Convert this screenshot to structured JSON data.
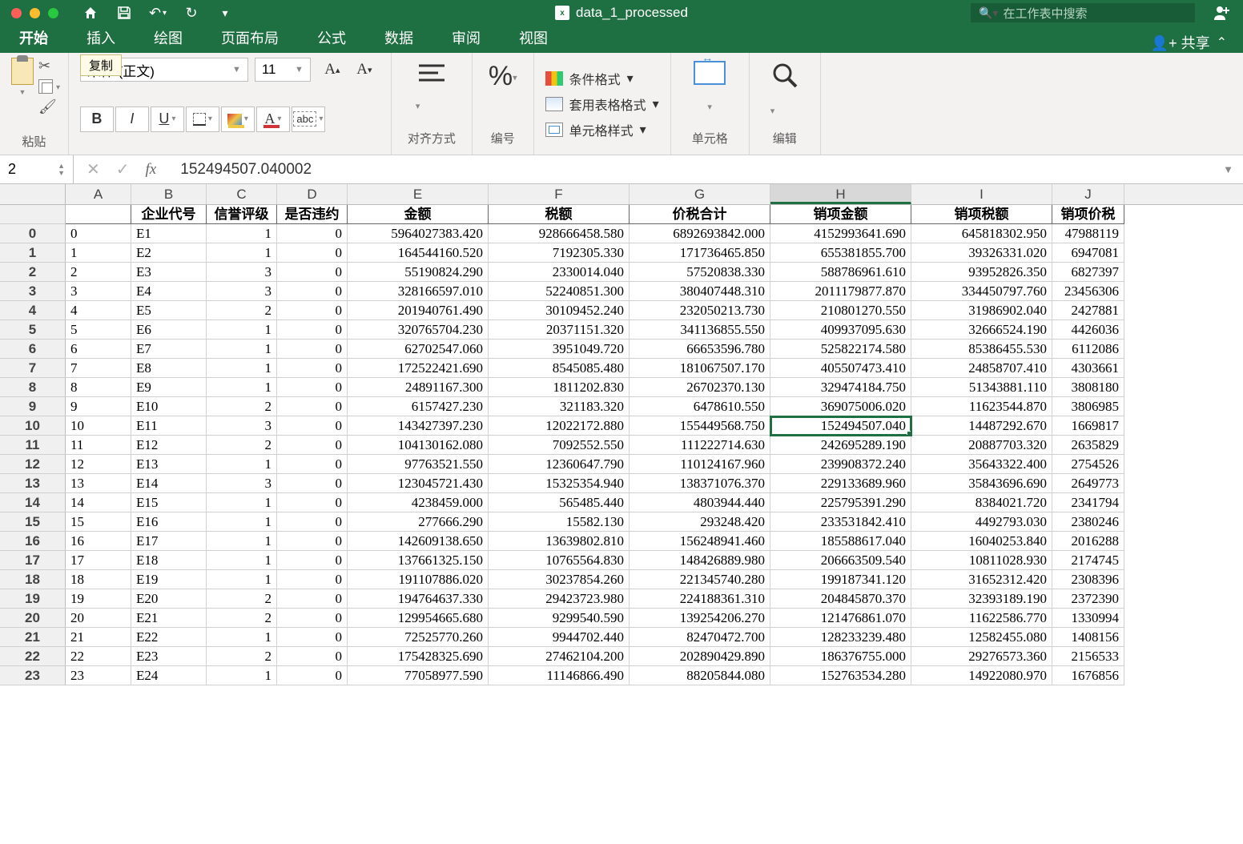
{
  "title": "data_1_processed",
  "search": {
    "placeholder": "在工作表中搜索"
  },
  "tooltip": "复制",
  "tabs": [
    "开始",
    "插入",
    "绘图",
    "页面布局",
    "公式",
    "数据",
    "审阅",
    "视图"
  ],
  "share": "共享",
  "ribbon": {
    "paste": "粘贴",
    "font_name": "宋体 (正文)",
    "font_size": "11",
    "align": "对齐方式",
    "number": "编号",
    "cond_format": "条件格式",
    "table_format": "套用表格格式",
    "cell_styles": "单元格样式",
    "cells": "单元格",
    "edit": "编辑"
  },
  "name_box": "2",
  "formula_value": "152494507.040002",
  "columns": [
    "A",
    "B",
    "C",
    "D",
    "E",
    "F",
    "G",
    "H",
    "I",
    "J"
  ],
  "col_widths": [
    "cw-A",
    "cw-B",
    "cw-C",
    "cw-D",
    "cw-E",
    "cw-F",
    "cw-G",
    "cw-H",
    "cw-I",
    "cw-J"
  ],
  "selected_col_index": 7,
  "header_row": [
    "",
    "企业代号",
    "信誉评级",
    "是否违约",
    "金额",
    "税额",
    "价税合计",
    "销项金额",
    "销项税额",
    "销项价税"
  ],
  "selected_cell": {
    "row": 11,
    "col": 7
  },
  "chart_data": {
    "type": "table",
    "row_labels": [
      "0",
      "1",
      "2",
      "3",
      "4",
      "5",
      "6",
      "7",
      "8",
      "9",
      "10",
      "11",
      "12",
      "13",
      "14",
      "15",
      "16",
      "17",
      "18",
      "19",
      "20",
      "21",
      "22",
      "23"
    ],
    "rows": [
      [
        "0",
        "E1",
        "1",
        "0",
        "5964027383.420",
        "928666458.580",
        "6892693842.000",
        "4152993641.690",
        "645818302.950",
        "47988119"
      ],
      [
        "1",
        "E2",
        "1",
        "0",
        "164544160.520",
        "7192305.330",
        "171736465.850",
        "655381855.700",
        "39326331.020",
        "6947081"
      ],
      [
        "2",
        "E3",
        "3",
        "0",
        "55190824.290",
        "2330014.040",
        "57520838.330",
        "588786961.610",
        "93952826.350",
        "6827397"
      ],
      [
        "3",
        "E4",
        "3",
        "0",
        "328166597.010",
        "52240851.300",
        "380407448.310",
        "2011179877.870",
        "334450797.760",
        "23456306"
      ],
      [
        "4",
        "E5",
        "2",
        "0",
        "201940761.490",
        "30109452.240",
        "232050213.730",
        "210801270.550",
        "31986902.040",
        "2427881"
      ],
      [
        "5",
        "E6",
        "1",
        "0",
        "320765704.230",
        "20371151.320",
        "341136855.550",
        "409937095.630",
        "32666524.190",
        "4426036"
      ],
      [
        "6",
        "E7",
        "1",
        "0",
        "62702547.060",
        "3951049.720",
        "66653596.780",
        "525822174.580",
        "85386455.530",
        "6112086"
      ],
      [
        "7",
        "E8",
        "1",
        "0",
        "172522421.690",
        "8545085.480",
        "181067507.170",
        "405507473.410",
        "24858707.410",
        "4303661"
      ],
      [
        "8",
        "E9",
        "1",
        "0",
        "24891167.300",
        "1811202.830",
        "26702370.130",
        "329474184.750",
        "51343881.110",
        "3808180"
      ],
      [
        "9",
        "E10",
        "2",
        "0",
        "6157427.230",
        "321183.320",
        "6478610.550",
        "369075006.020",
        "11623544.870",
        "3806985"
      ],
      [
        "10",
        "E11",
        "3",
        "0",
        "143427397.230",
        "12022172.880",
        "155449568.750",
        "152494507.040",
        "14487292.670",
        "1669817"
      ],
      [
        "11",
        "E12",
        "2",
        "0",
        "104130162.080",
        "7092552.550",
        "111222714.630",
        "242695289.190",
        "20887703.320",
        "2635829"
      ],
      [
        "12",
        "E13",
        "1",
        "0",
        "97763521.550",
        "12360647.790",
        "110124167.960",
        "239908372.240",
        "35643322.400",
        "2754526"
      ],
      [
        "13",
        "E14",
        "3",
        "0",
        "123045721.430",
        "15325354.940",
        "138371076.370",
        "229133689.960",
        "35843696.690",
        "2649773"
      ],
      [
        "14",
        "E15",
        "1",
        "0",
        "4238459.000",
        "565485.440",
        "4803944.440",
        "225795391.290",
        "8384021.720",
        "2341794"
      ],
      [
        "15",
        "E16",
        "1",
        "0",
        "277666.290",
        "15582.130",
        "293248.420",
        "233531842.410",
        "4492793.030",
        "2380246"
      ],
      [
        "16",
        "E17",
        "1",
        "0",
        "142609138.650",
        "13639802.810",
        "156248941.460",
        "185588617.040",
        "16040253.840",
        "2016288"
      ],
      [
        "17",
        "E18",
        "1",
        "0",
        "137661325.150",
        "10765564.830",
        "148426889.980",
        "206663509.540",
        "10811028.930",
        "2174745"
      ],
      [
        "18",
        "E19",
        "1",
        "0",
        "191107886.020",
        "30237854.260",
        "221345740.280",
        "199187341.120",
        "31652312.420",
        "2308396"
      ],
      [
        "19",
        "E20",
        "2",
        "0",
        "194764637.330",
        "29423723.980",
        "224188361.310",
        "204845870.370",
        "32393189.190",
        "2372390"
      ],
      [
        "20",
        "E21",
        "2",
        "0",
        "129954665.680",
        "9299540.590",
        "139254206.270",
        "121476861.070",
        "11622586.770",
        "1330994"
      ],
      [
        "21",
        "E22",
        "1",
        "0",
        "72525770.260",
        "9944702.440",
        "82470472.700",
        "128233239.480",
        "12582455.080",
        "1408156"
      ],
      [
        "22",
        "E23",
        "2",
        "0",
        "175428325.690",
        "27462104.200",
        "202890429.890",
        "186376755.000",
        "29276573.360",
        "2156533"
      ],
      [
        "23",
        "E24",
        "1",
        "0",
        "77058977.590",
        "11146866.490",
        "88205844.080",
        "152763534.280",
        "14922080.970",
        "1676856"
      ]
    ]
  }
}
